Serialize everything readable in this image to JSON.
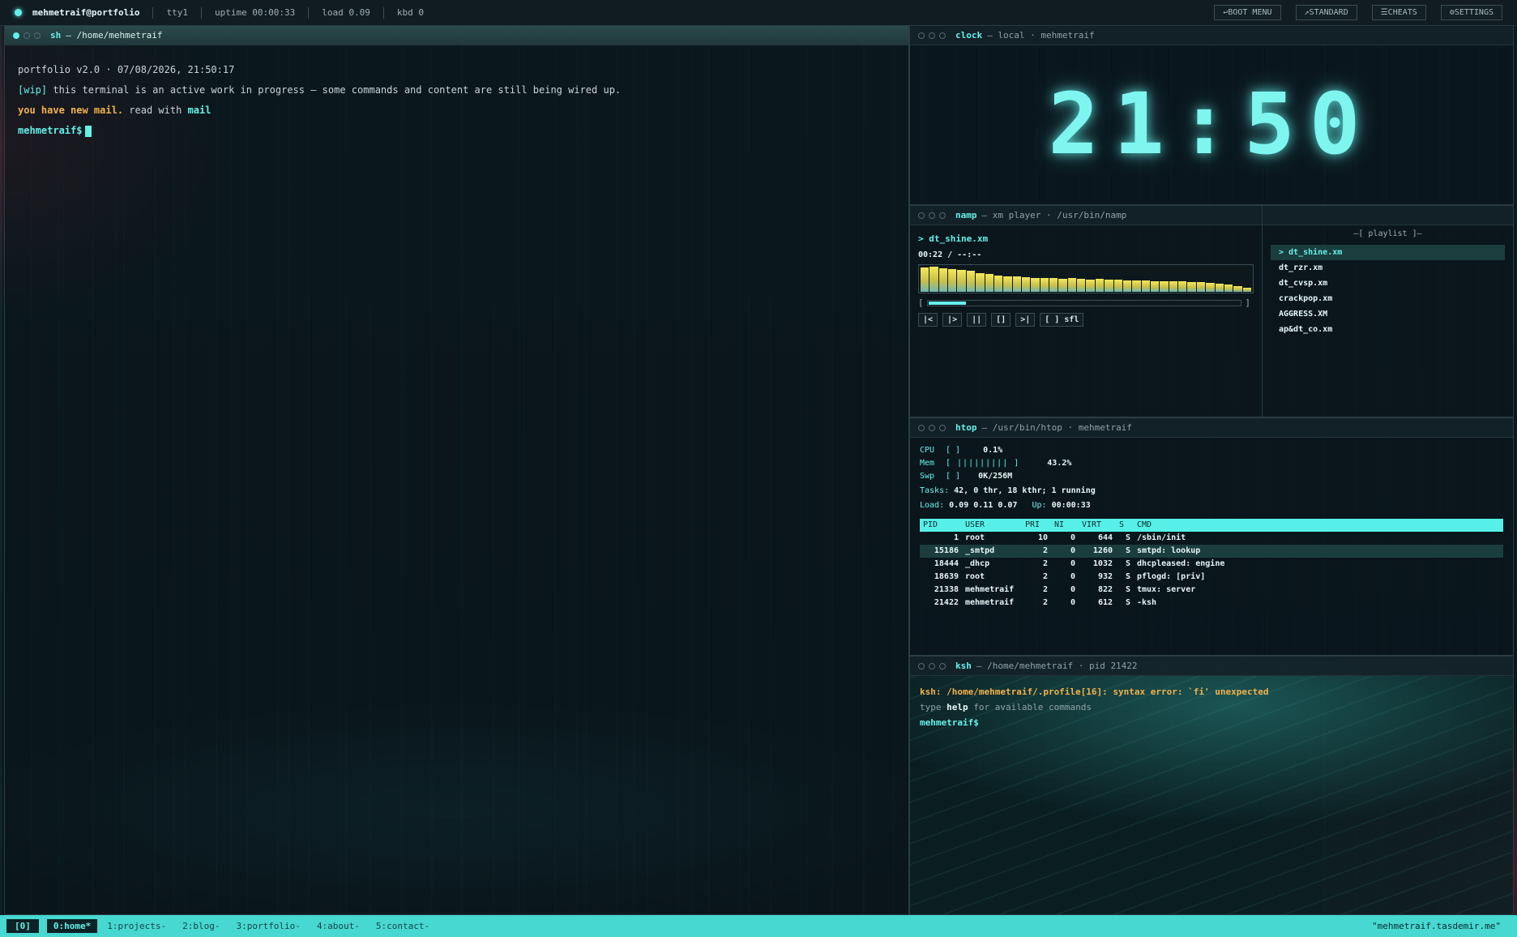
{
  "topbar": {
    "host": "mehmetraif@portfolio",
    "tty": "tty1",
    "uptime": "uptime 00:00:33",
    "load": "load 0.09",
    "kbd": "kbd 0",
    "buttons": [
      "↩BOOT MENU",
      "↗STANDARD",
      "☰CHEATS",
      "⚙SETTINGS"
    ]
  },
  "main": {
    "head_name": "sh",
    "head_path": "— /home/mehmetraif",
    "line1": "portfolio v2.0 · 07/08/2026, 21:50:17",
    "wip_tag": "[wip]",
    "wip_text": " this terminal is an active work in progress — some commands and content are still being wired up.",
    "mail_warn": "you have new mail.",
    "mail_read": " read with ",
    "mail_cmd": "mail",
    "prompt": "mehmetraif$"
  },
  "clock": {
    "head_name": "clock",
    "head_path": "— local · mehmetraif",
    "time": "21:50"
  },
  "namp": {
    "head_name": "namp",
    "head_path": "— xm player · /usr/bin/namp",
    "now_playing": "> dt_shine.xm",
    "time": "00:22 / --:--",
    "progress": 0.12,
    "spectrum": [
      0.95,
      0.98,
      0.9,
      0.88,
      0.85,
      0.8,
      0.72,
      0.7,
      0.62,
      0.6,
      0.58,
      0.55,
      0.54,
      0.52,
      0.53,
      0.5,
      0.52,
      0.5,
      0.48,
      0.5,
      0.47,
      0.46,
      0.45,
      0.44,
      0.43,
      0.42,
      0.42,
      0.4,
      0.4,
      0.38,
      0.36,
      0.34,
      0.3,
      0.28,
      0.22,
      0.16
    ],
    "controls": [
      "|<",
      "|>",
      "||",
      "[]",
      ">|",
      "[ ] sfl"
    ],
    "playlist_title": "—[ playlist ]—",
    "playlist": [
      "> dt_shine.xm",
      "dt_rzr.xm",
      "dt_cvsp.xm",
      "crackpop.xm",
      "AGGRESS.XM",
      "ap&dt_co.xm"
    ]
  },
  "htop": {
    "head_name": "htop",
    "head_path": "— /usr/bin/htop · mehmetraif",
    "cpu_label": "CPU",
    "cpu_bars": "[   ]",
    "cpu_val": "0.1%",
    "mem_label": "Mem",
    "mem_bars": "[ ||||||||| ]",
    "mem_val": "43.2%",
    "swp_label": "Swp",
    "swp_bars": "[  ]",
    "swp_val": "0K/256M",
    "tasks_k": "Tasks:",
    "tasks_v": " 42, 0 thr, 18 kthr; 1 running",
    "load_k": "Load:",
    "load_v": " 0.09 0.11 0.07",
    "up_k": "Up:",
    "up_v": " 00:00:33",
    "columns": [
      "PID",
      "USER",
      "PRI",
      "NI",
      "VIRT",
      "S",
      "CMD"
    ],
    "rows": [
      [
        "1",
        "root",
        "10",
        "0",
        "644",
        "S",
        "/sbin/init"
      ],
      [
        "15186",
        "_smtpd",
        "2",
        "0",
        "1260",
        "S",
        "smtpd: lookup"
      ],
      [
        "18444",
        "_dhcp",
        "2",
        "0",
        "1032",
        "S",
        "dhcpleased: engine"
      ],
      [
        "18639",
        "root",
        "2",
        "0",
        "932",
        "S",
        "pflogd: [priv]"
      ],
      [
        "21338",
        "mehmetraif",
        "2",
        "0",
        "822",
        "S",
        "tmux: server"
      ],
      [
        "21422",
        "mehmetraif",
        "2",
        "0",
        "612",
        "S",
        "-ksh"
      ]
    ]
  },
  "ksh": {
    "head_name": "ksh",
    "head_path": "— /home/mehmetraif · pid 21422",
    "error": "ksh: /home/mehmetraif/.profile[16]: syntax error: `fi' unexpected",
    "hint_pre": "type ",
    "hint_cmd": "help",
    "hint_post": " for available commands",
    "prompt": "mehmetraif$"
  },
  "bottombar": {
    "session": "[0]",
    "windows": [
      "0:home*",
      "1:projects-",
      "2:blog-",
      "3:portfolio-",
      "4:about-",
      "5:contact-"
    ],
    "host": "\"mehmetraif.tasdemir.me\""
  }
}
